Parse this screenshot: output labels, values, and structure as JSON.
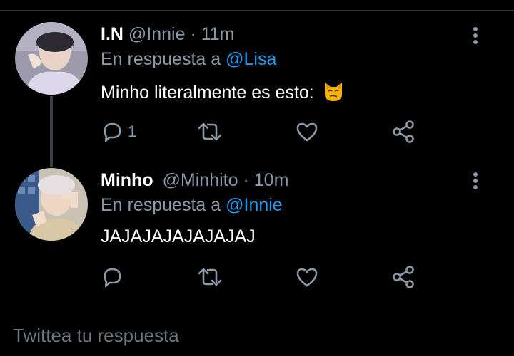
{
  "tweets": [
    {
      "name": "I.N",
      "handle": "@Innie",
      "time": "· 11m",
      "reply_prefix": "En respuesta a",
      "reply_to": "@Lisa",
      "text": "Minho literalmente es esto:",
      "emoji": "smirking-cat-emoji",
      "reply_count": "1"
    },
    {
      "name": "Minho",
      "handle": "@Minhito",
      "time": "· 10m",
      "reply_prefix": "En respuesta a",
      "reply_to": "@Innie",
      "text": "JAJAJAJAJAJAJAJ",
      "reply_count": ""
    }
  ],
  "composer": {
    "placeholder": "Twittea tu respuesta"
  },
  "icons": [
    "reply-icon",
    "retweet-icon",
    "like-icon",
    "share-icon",
    "more-icon"
  ],
  "colors": {
    "background": "#000000",
    "mention": "#1d9bf0",
    "secondary_text": "#8b98a5",
    "divider": "#2f3336"
  }
}
